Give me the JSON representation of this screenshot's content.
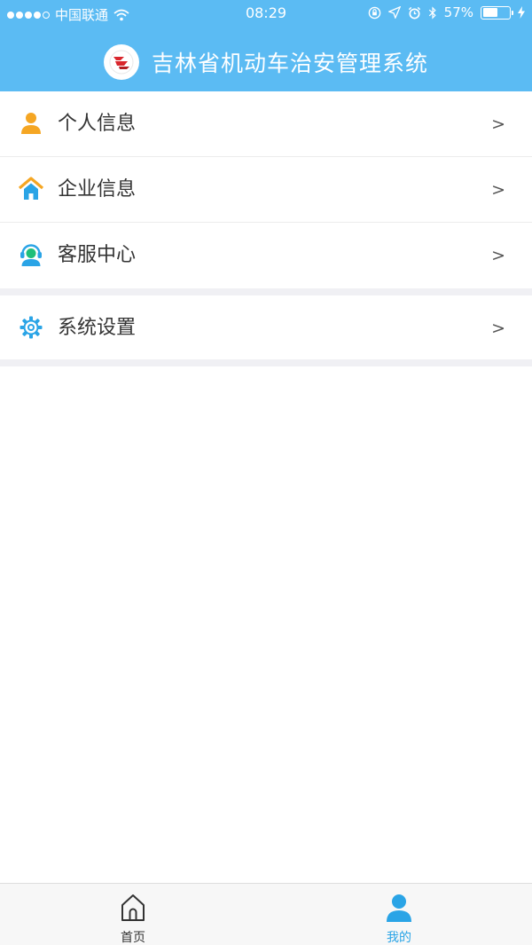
{
  "status_bar": {
    "carrier": "中国联通",
    "time": "08:29",
    "battery": "57%",
    "battery_level": 0.57,
    "icons": [
      "signal-dots",
      "wifi-icon",
      "orientation-lock-icon",
      "location-icon",
      "alarm-icon",
      "bluetooth-icon",
      "battery-icon",
      "charging-icon"
    ]
  },
  "header": {
    "title": "吉林省机动车治安管理系统",
    "logo_icon": "app-logo-icon"
  },
  "menu": {
    "items": [
      {
        "label": "个人信息",
        "icon": "user-icon",
        "arrow": ">"
      },
      {
        "label": "企业信息",
        "icon": "home-icon",
        "arrow": ">"
      },
      {
        "label": "客服中心",
        "icon": "customer-service-icon",
        "arrow": ">"
      },
      {
        "label": "系统设置",
        "icon": "gear-icon",
        "arrow": ">"
      }
    ]
  },
  "tabbar": {
    "tabs": [
      {
        "label": "首页",
        "icon": "home-outline-icon",
        "active": false
      },
      {
        "label": "我的",
        "icon": "profile-icon",
        "active": true
      }
    ]
  },
  "colors": {
    "header": "#5bbbf3",
    "user_icon": "#f5a623",
    "home_icon": "#2aa4e6",
    "home_roof": "#f5a623",
    "gear_icon": "#2aa4e6",
    "tab_active": "#2aa4e6",
    "divider": "#f0f0f4"
  }
}
